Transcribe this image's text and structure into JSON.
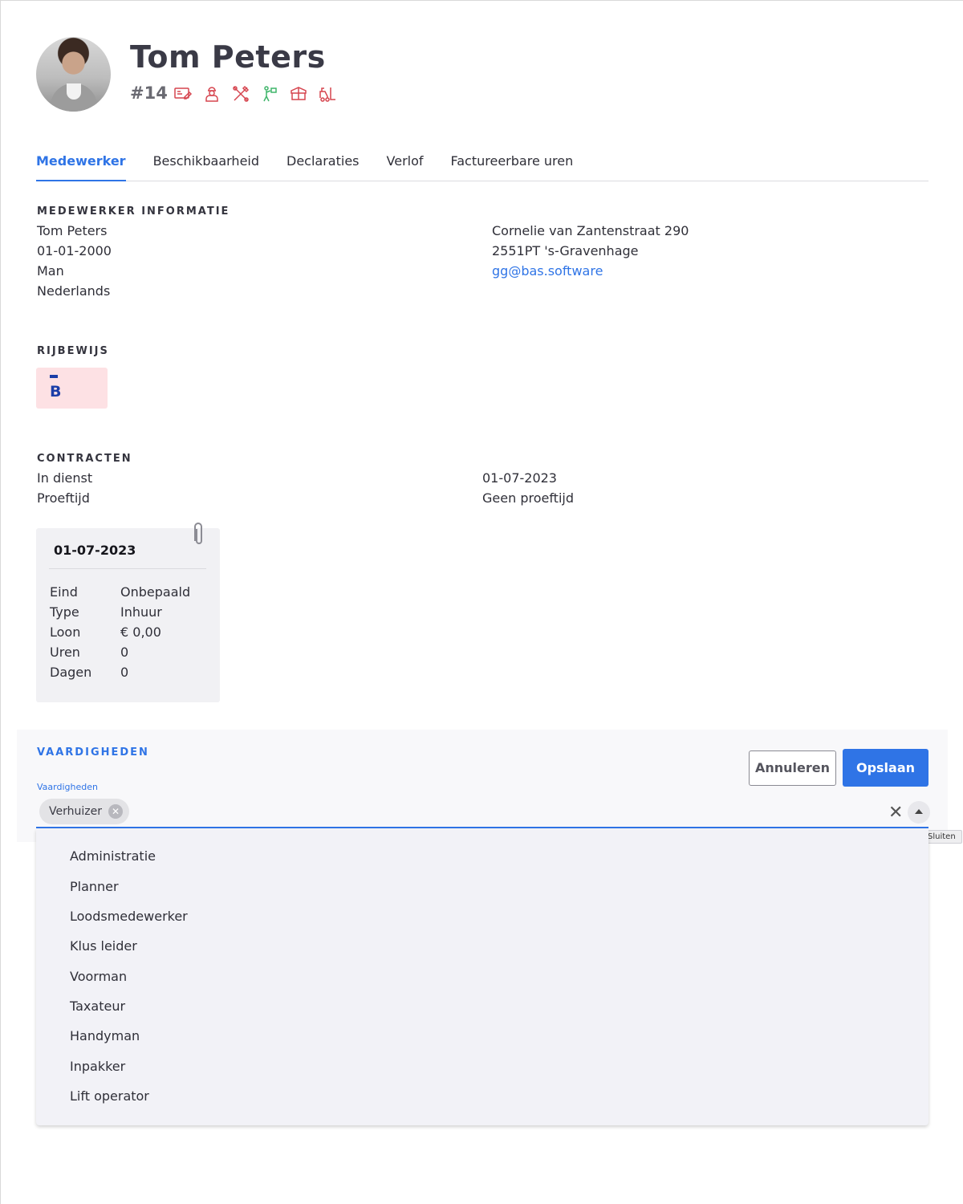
{
  "profile": {
    "name": "Tom Peters",
    "employee_number": "#14",
    "role_icons": [
      "payment-card-icon",
      "worker-icon",
      "tools-icon",
      "assembler-icon",
      "box-icon",
      "forklift-icon"
    ]
  },
  "tabs": [
    {
      "label": "Medewerker",
      "active": true
    },
    {
      "label": "Beschikbaarheid",
      "active": false
    },
    {
      "label": "Declaraties",
      "active": false
    },
    {
      "label": "Verlof",
      "active": false
    },
    {
      "label": "Factureerbare uren",
      "active": false
    }
  ],
  "employee_info": {
    "title": "MEDEWERKER INFORMATIE",
    "name": "Tom Peters",
    "birthdate": "01-01-2000",
    "gender": "Man",
    "nationality": "Nederlands",
    "street": "Cornelie van Zantenstraat 290",
    "city": "2551PT 's-Gravenhage",
    "email": "gg@bas.software"
  },
  "license": {
    "title": "RIJBEWIJS",
    "category": "B"
  },
  "contracts": {
    "title": "CONTRACTEN",
    "in_service_label": "In dienst",
    "in_service_value": "01-07-2023",
    "probation_label": "Proeftijd",
    "probation_value": "Geen proeftijd",
    "card": {
      "date": "01-07-2023",
      "rows": [
        {
          "key": "Eind",
          "value": "Onbepaald"
        },
        {
          "key": "Type",
          "value": "Inhuur"
        },
        {
          "key": "Loon",
          "value": "€ 0,00"
        },
        {
          "key": "Uren",
          "value": "0"
        },
        {
          "key": "Dagen",
          "value": "0"
        }
      ]
    }
  },
  "skills": {
    "title": "VAARDIGHEDEN",
    "field_label": "Vaardigheden",
    "selected": [
      "Verhuizer"
    ],
    "cancel_label": "Annuleren",
    "save_label": "Opslaan",
    "tooltip": "Sluiten",
    "options": [
      "Administratie",
      "Planner",
      "Loodsmedewerker",
      "Klus leider",
      "Voorman",
      "Taxateur",
      "Handyman",
      "Inpakker",
      "Lift operator"
    ]
  },
  "colors": {
    "accent": "#2f74e6",
    "icon_red": "#d6454f",
    "icon_green": "#3fb56a",
    "license_bg": "#fde1e4",
    "license_fg": "#1b3ea8"
  }
}
